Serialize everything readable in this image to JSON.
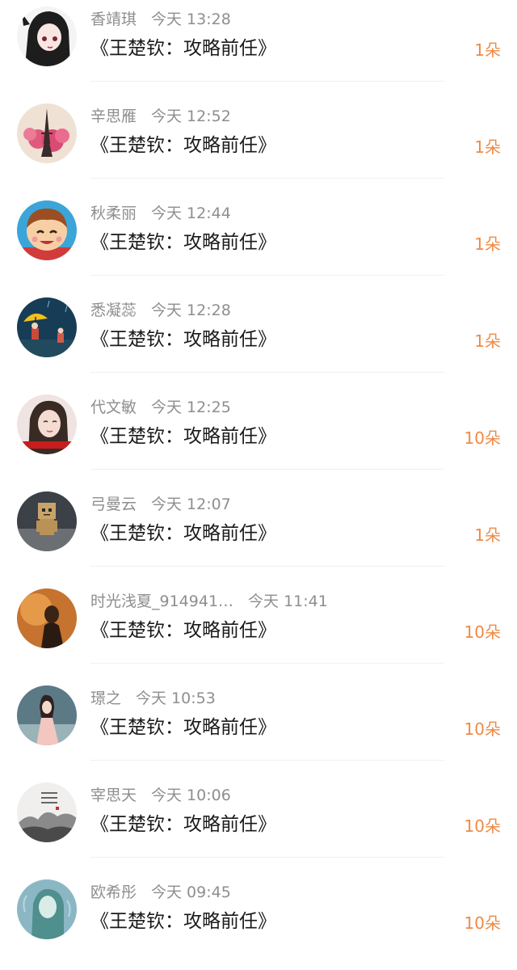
{
  "items": [
    {
      "name": "香靖琪",
      "time": "今天 13:28",
      "title": "《王楚钦：攻略前任》",
      "amount": "1朵"
    },
    {
      "name": "辛思雁",
      "time": "今天 12:52",
      "title": "《王楚钦：攻略前任》",
      "amount": "1朵"
    },
    {
      "name": "秋柔丽",
      "time": "今天 12:44",
      "title": "《王楚钦：攻略前任》",
      "amount": "1朵"
    },
    {
      "name": "悉凝蕊",
      "time": "今天 12:28",
      "title": "《王楚钦：攻略前任》",
      "amount": "1朵"
    },
    {
      "name": "代文敏",
      "time": "今天 12:25",
      "title": "《王楚钦：攻略前任》",
      "amount": "10朵"
    },
    {
      "name": "弓曼云",
      "time": "今天 12:07",
      "title": "《王楚钦：攻略前任》",
      "amount": "1朵"
    },
    {
      "name": "时光浅夏_914941…",
      "time": "今天 11:41",
      "title": "《王楚钦：攻略前任》",
      "amount": "10朵"
    },
    {
      "name": "璟之",
      "time": "今天 10:53",
      "title": "《王楚钦：攻略前任》",
      "amount": "10朵"
    },
    {
      "name": "宰思天",
      "time": "今天 10:06",
      "title": "《王楚钦：攻略前任》",
      "amount": "10朵"
    },
    {
      "name": "欧希彤",
      "time": "今天 09:45",
      "title": "《王楚钦：攻略前任》",
      "amount": "10朵"
    }
  ],
  "colors": {
    "accent": "#ef8a45",
    "name_text": "#8e8e8e",
    "title_text": "#1a1a1a"
  }
}
